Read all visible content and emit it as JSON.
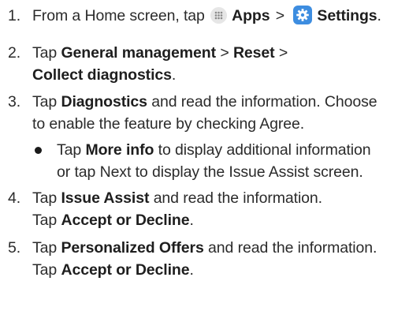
{
  "steps": [
    {
      "number": "1.",
      "prefix": "From a Home screen, tap",
      "apps_label": "Apps",
      "sep": ">",
      "settings_label": "Settings",
      "suffix": "."
    },
    {
      "number": "2.",
      "tap": "Tap",
      "general": "General management",
      "sep1": ">",
      "reset": "Reset",
      "sep2": ">",
      "collect": "Collect diagnostics",
      "suffix": "."
    },
    {
      "number": "3.",
      "tap": "Tap",
      "diagnostics": "Diagnostics",
      "rest1": "and read the information. Choose",
      "rest2": "to enable the feature by checking Agree."
    },
    {
      "number": "4.",
      "tap": "Tap",
      "issue_assist": "Issue Assist",
      "rest1": "and read the information.",
      "tap2": "Tap",
      "accept": "Accept or Decline",
      "suffix": "."
    },
    {
      "number": "5.",
      "tap": "Tap",
      "offers": "Personalized Offers",
      "rest1": "and read the information.",
      "tap2": "Tap",
      "accept": "Accept or Decline",
      "suffix": "."
    }
  ],
  "bullet": {
    "tap": "Tap",
    "more_info": "More info",
    "rest1": "to display additional information",
    "rest2": "or tap Next to display the Issue Assist screen."
  },
  "icons": {
    "apps": "apps-grid-icon",
    "settings": "settings-gear-icon"
  },
  "colors": {
    "text": "#2b2b2b",
    "settings_icon_bg": "#3d8de0",
    "apps_icon_bg": "#e6e6e6"
  }
}
